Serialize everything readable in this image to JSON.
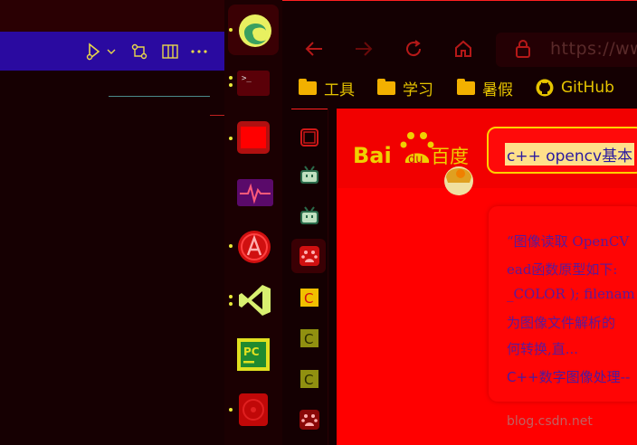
{
  "browser": {
    "url": "https://ww",
    "bookmarks": [
      {
        "label": "工具",
        "icon": "folder-icon"
      },
      {
        "label": "学习",
        "icon": "folder-icon"
      },
      {
        "label": "暑假",
        "icon": "folder-icon"
      },
      {
        "label": "GitHub",
        "icon": "github-icon"
      }
    ]
  },
  "page": {
    "logo": "Baidu百度",
    "search_query": "c++ opencv基本",
    "result_lines": [
      "“图像读取 OpenCV",
      "ead函数原型如下:",
      "_COLOR ); filenam",
      "为图像文件解析的",
      "何转换,直...",
      "C++数字图像处理--"
    ],
    "result_site": "blog.csdn.net"
  },
  "colors": {
    "accent": "#ff0000",
    "highlight": "#e8e838",
    "toolbar": "#2a0aa0"
  }
}
